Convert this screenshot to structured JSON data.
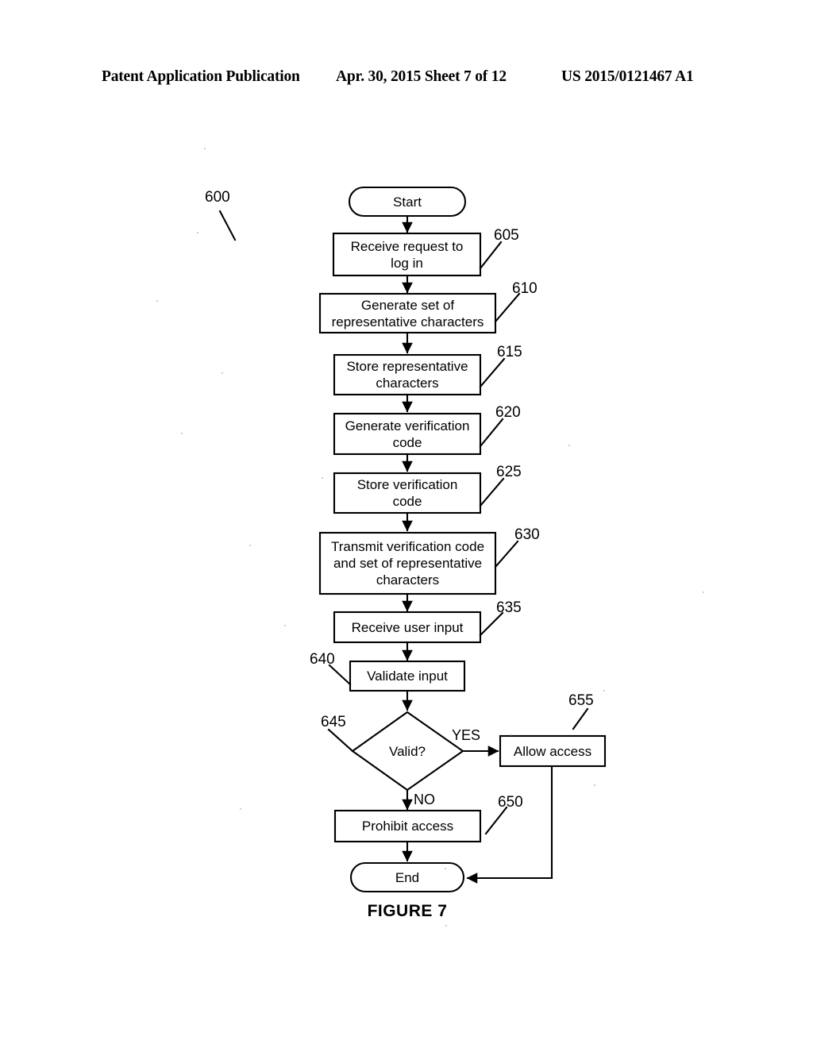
{
  "header": {
    "left": "Patent Application Publication",
    "middle": "Apr. 30, 2015  Sheet 7 of 12",
    "right": "US 2015/0121467 A1"
  },
  "figure": {
    "caption": "FIGURE 7",
    "diagram_ref": "600",
    "nodes": [
      {
        "id": "start",
        "type": "terminator",
        "label": "Start"
      },
      {
        "id": "n605",
        "type": "process",
        "label": "Receive request to\nlog in",
        "ref": "605"
      },
      {
        "id": "n610",
        "type": "process",
        "label": "Generate set of\nrepresentative characters",
        "ref": "610"
      },
      {
        "id": "n615",
        "type": "process",
        "label": "Store representative\ncharacters",
        "ref": "615"
      },
      {
        "id": "n620",
        "type": "process",
        "label": "Generate verification\ncode",
        "ref": "620"
      },
      {
        "id": "n625",
        "type": "process",
        "label": "Store verification\ncode",
        "ref": "625"
      },
      {
        "id": "n630",
        "type": "process",
        "label": "Transmit verification code\nand set of representative\ncharacters",
        "ref": "630"
      },
      {
        "id": "n635",
        "type": "process",
        "label": "Receive user input",
        "ref": "635"
      },
      {
        "id": "n640",
        "type": "process",
        "label": "Validate input",
        "ref": "640"
      },
      {
        "id": "n645",
        "type": "decision",
        "label": "Valid?",
        "ref": "645"
      },
      {
        "id": "n655",
        "type": "process",
        "label": "Allow access",
        "ref": "655"
      },
      {
        "id": "n650",
        "type": "process",
        "label": "Prohibit access",
        "ref": "650"
      },
      {
        "id": "end",
        "type": "terminator",
        "label": "End"
      }
    ],
    "edge_labels": {
      "yes": "YES",
      "no": "NO"
    }
  },
  "colors": {
    "ink": "#000000",
    "paper": "#ffffff"
  }
}
